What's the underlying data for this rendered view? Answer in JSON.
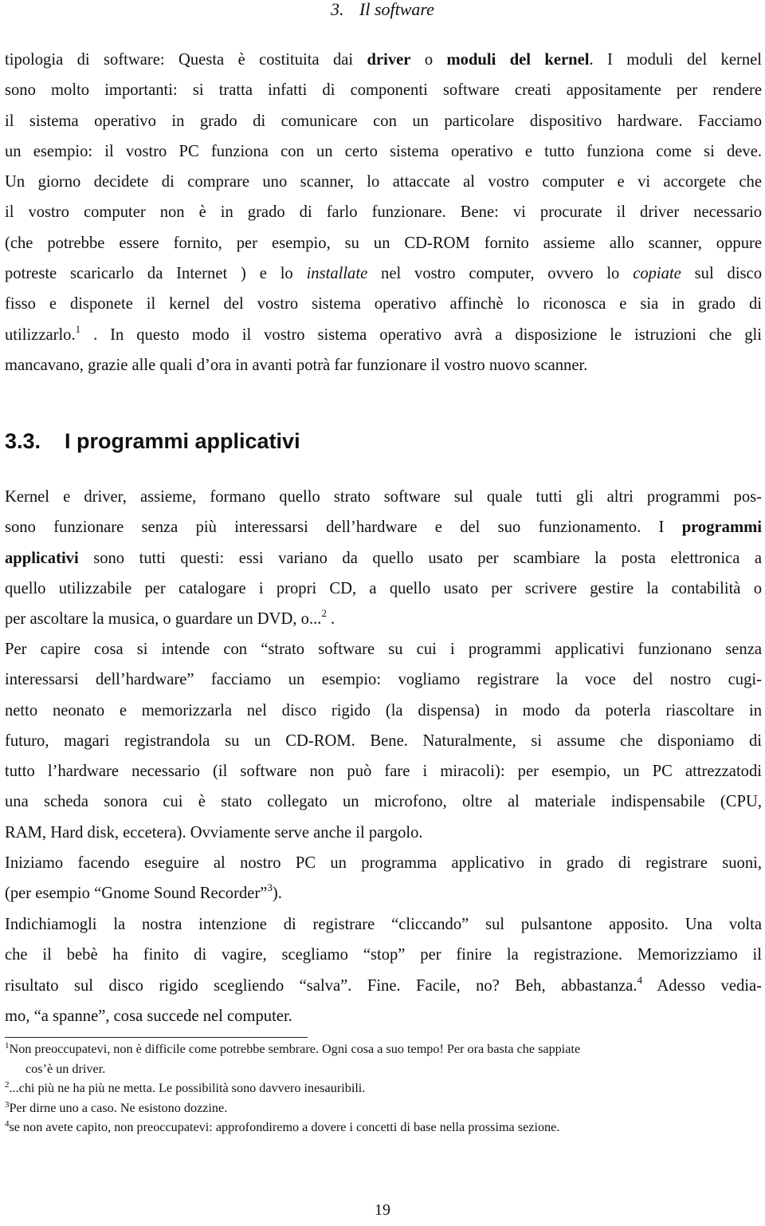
{
  "running_head": {
    "chapter_number": "3.",
    "chapter_title": "Il software"
  },
  "para1": {
    "l1_a": "tipologia di software: Questa è costituita dai ",
    "l1_b": "driver",
    "l1_c": " o ",
    "l1_d": "moduli del kernel",
    "l1_e": ". I moduli del kernel",
    "l2": "sono molto importanti: si tratta infatti di componenti software creati appositamente per rendere",
    "l3": "il sistema operativo in grado di comunicare con un particolare dispositivo hardware. Facciamo",
    "l4": "un esempio: il vostro PC funziona con un certo sistema operativo e tutto funziona come si deve.",
    "l5": "Un giorno decidete di comprare uno scanner, lo attaccate al vostro computer e vi accorgete che",
    "l6": "il vostro computer non è in grado di farlo funzionare. Bene: vi procurate il driver necessario",
    "l7": "(che potrebbe essere fornito, per esempio, su un CD-ROM fornito assieme allo scanner, oppure",
    "l8_a": "potreste scaricarlo da Internet ) e lo ",
    "l8_b": "installate",
    "l8_c": " nel vostro computer, ovvero lo ",
    "l8_d": "copiate",
    "l8_e": " sul disco",
    "l9": "fisso e disponete il kernel del vostro sistema operativo affinchè lo riconosca e sia in grado di",
    "l10_a": "utilizzarlo.",
    "l10_fn": "1",
    "l10_b": " . In questo modo il vostro sistema operativo avrà a disposizione le istruzioni che gli",
    "l11": "mancavano, grazie alle quali d’ora in avanti potrà far funzionare il vostro nuovo scanner."
  },
  "section": {
    "number": "3.3.",
    "title": "I programmi applicativi"
  },
  "para2": {
    "l1": "Kernel e driver, assieme, formano quello strato software sul quale tutti gli altri programmi pos-",
    "l2_a": "sono funzionare senza più interessarsi dell’hardware e del suo funzionamento. I ",
    "l2_b": "programmi",
    "l3_a": "applicativi",
    "l3_b": " sono tutti questi: essi variano da quello usato per scambiare la posta elettronica a",
    "l4": "quello utilizzabile per catalogare i propri CD, a quello usato per scrivere gestire la contabilità o",
    "l5_a": "per ascoltare la musica, o guardare un DVD, o...",
    "l5_fn": "2",
    "l5_b": " ."
  },
  "para3": {
    "l1": "Per capire cosa si intende con “strato software su cui i programmi applicativi funzionano senza",
    "l2": "interessarsi dell’hardware” facciamo un esempio: vogliamo registrare la voce del nostro cugi-",
    "l3": "netto neonato e memorizzarla nel disco rigido (la dispensa) in modo da poterla riascoltare in",
    "l4": "futuro, magari registrandola su un CD-ROM. Bene. Naturalmente, si assume che disponiamo di",
    "l5": "tutto l’hardware necessario (il software non può fare i miracoli): per esempio, un PC attrezzatodi",
    "l6": "una scheda sonora cui è stato collegato un microfono, oltre al materiale indispensabile (CPU,",
    "l7": "RAM, Hard disk, eccetera). Ovviamente serve anche il pargolo."
  },
  "para4": {
    "l1": "Iniziamo facendo eseguire al nostro PC un programma applicativo in grado di registrare suoni,",
    "l2_a": "(per esempio “Gnome Sound Recorder”",
    "l2_fn": "3",
    "l2_b": ")."
  },
  "para5": {
    "l1": "Indichiamogli la nostra intenzione di registrare “cliccando” sul pulsantone apposito. Una volta",
    "l2": "che il bebè ha finito di vagire, scegliamo “stop” per finire la registrazione. Memorizziamo il",
    "l3_a": "risultato sul disco rigido scegliendo “salva”. Fine. Facile, no? Beh, abbastanza.",
    "l3_fn": "4",
    "l3_b": " Adesso vedia-",
    "l4": "mo, “a spanne”, cosa succede nel computer."
  },
  "footnotes": [
    {
      "mark": "1",
      "text": "Non preoccupatevi, non è difficile come potrebbe sembrare. Ogni cosa a suo tempo! Per ora basta che sappiate",
      "cont": "cos’è un driver."
    },
    {
      "mark": "2",
      "text": "...chi più ne ha più ne metta. Le possibilità sono davvero inesauribili."
    },
    {
      "mark": "3",
      "text": "Per dirne uno a caso. Ne esistono dozzine."
    },
    {
      "mark": "4",
      "text": "se non avete capito, non preoccupatevi: approfondiremo a dovere i concetti di base nella prossima sezione."
    }
  ],
  "page_number": "19"
}
